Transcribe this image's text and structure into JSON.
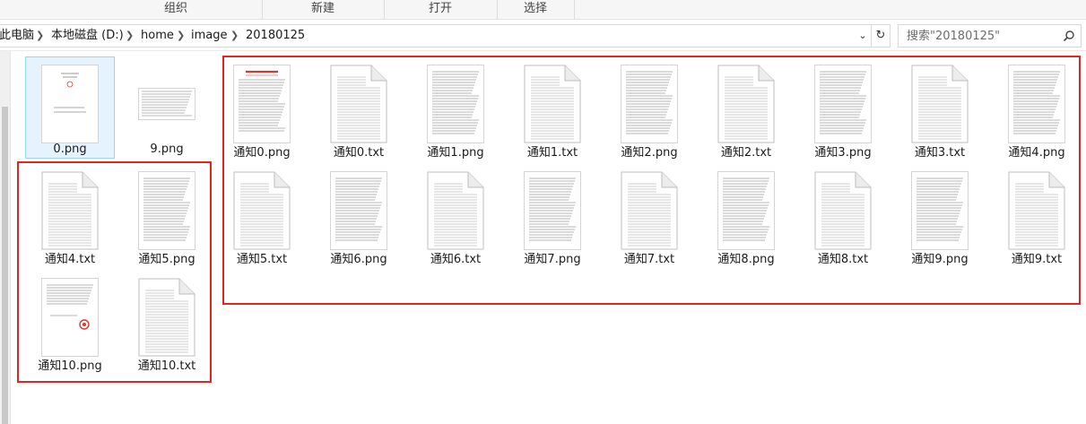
{
  "ribbon": {
    "groups": [
      "组织",
      "新建",
      "打开",
      "选择"
    ]
  },
  "address": {
    "crumbs": [
      "此电脑",
      "本地磁盘 (D:)",
      "home",
      "image",
      "20180125"
    ]
  },
  "search": {
    "placeholder": "搜索\"20180125\""
  },
  "files": [
    {
      "name": "0.png",
      "kind": "png-cover",
      "selected": true
    },
    {
      "name": "9.png",
      "kind": "png-landscape",
      "selected": false
    },
    {
      "name": "通知0.png",
      "kind": "png-redhead",
      "selected": false
    },
    {
      "name": "通知0.txt",
      "kind": "txt",
      "selected": false
    },
    {
      "name": "通知1.png",
      "kind": "png-doc",
      "selected": false
    },
    {
      "name": "通知1.txt",
      "kind": "txt",
      "selected": false
    },
    {
      "name": "通知2.png",
      "kind": "png-doc",
      "selected": false
    },
    {
      "name": "通知2.txt",
      "kind": "txt",
      "selected": false
    },
    {
      "name": "通知3.png",
      "kind": "png-doc",
      "selected": false
    },
    {
      "name": "通知3.txt",
      "kind": "txt",
      "selected": false
    },
    {
      "name": "通知4.png",
      "kind": "png-doc",
      "selected": false
    },
    {
      "name": "通知4.txt",
      "kind": "txt",
      "selected": false
    },
    {
      "name": "通知5.png",
      "kind": "png-doc",
      "selected": false
    },
    {
      "name": "通知5.txt",
      "kind": "txt",
      "selected": false
    },
    {
      "name": "通知6.png",
      "kind": "png-doc",
      "selected": false
    },
    {
      "name": "通知6.txt",
      "kind": "txt",
      "selected": false
    },
    {
      "name": "通知7.png",
      "kind": "png-doc",
      "selected": false
    },
    {
      "name": "通知7.txt",
      "kind": "txt",
      "selected": false
    },
    {
      "name": "通知8.png",
      "kind": "png-doc",
      "selected": false
    },
    {
      "name": "通知8.txt",
      "kind": "txt",
      "selected": false
    },
    {
      "name": "通知9.png",
      "kind": "png-doc",
      "selected": false
    },
    {
      "name": "通知9.txt",
      "kind": "txt",
      "selected": false
    },
    {
      "name": "通知10.png",
      "kind": "png-seal",
      "selected": false
    },
    {
      "name": "通知10.txt",
      "kind": "txt",
      "selected": false
    }
  ],
  "colors": {
    "highlight": "#e5231f",
    "selection_border": "#99d1ff",
    "selection_fill": "#e5f3ff",
    "seal_red": "#d9372b"
  }
}
